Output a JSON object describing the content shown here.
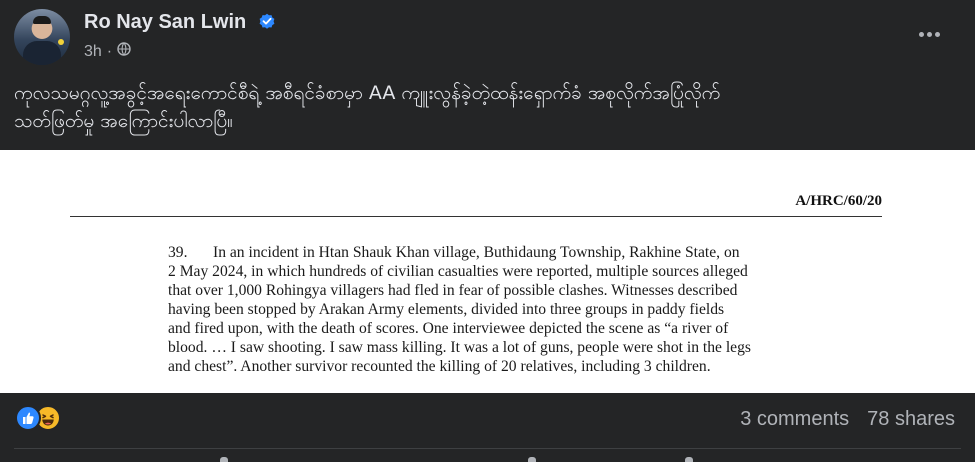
{
  "post": {
    "author": "Ro Nay San Lwin",
    "time": "3h",
    "separator": "·",
    "text_line1": "ကုလသမဂ္ဂလူ့အခွင့်အရေးကောင်စီရဲ့ အစီရင်ခံစာမှာ AA ကျူးလွန်ခဲ့တဲ့ထန်းရှောက်ခံ အစုလိုက်အပြုံလိုက်",
    "text_line2": "သတ်ဖြတ်မှု အကြောင်းပါလာပြီ။"
  },
  "document": {
    "ref": "A/HRC/60/20",
    "para_number": "39.",
    "lines": [
      "In an incident in Htan Shauk Khan village, Buthidaung Township, Rakhine State, on",
      "2 May 2024, in which hundreds of civilian casualties were reported, multiple sources alleged",
      "that over 1,000 Rohingya villagers had fled in fear of possible clashes. Witnesses described",
      "having been stopped by Arakan Army elements, divided into three groups in paddy fields",
      "and fired upon, with the death of scores. One interviewee depicted the scene as “a river of",
      "blood. … I saw shooting. I saw mass killing. It was a lot of guns, people were shot in the legs",
      "and chest”. Another survivor recounted the killing of 20 relatives, including 3 children."
    ]
  },
  "engagement": {
    "comments": "3 comments",
    "shares": "78 shares"
  },
  "icons": {
    "verified": "verified-badge-icon",
    "audience": "globe-icon",
    "more": "more-options-icon",
    "reactions": [
      "like-icon",
      "haha-icon"
    ]
  },
  "colors": {
    "background": "#242526",
    "verified": "#2d88ff",
    "like": "#2d88ff",
    "haha": "#f7b928",
    "secondary_text": "#b0b3b8"
  }
}
